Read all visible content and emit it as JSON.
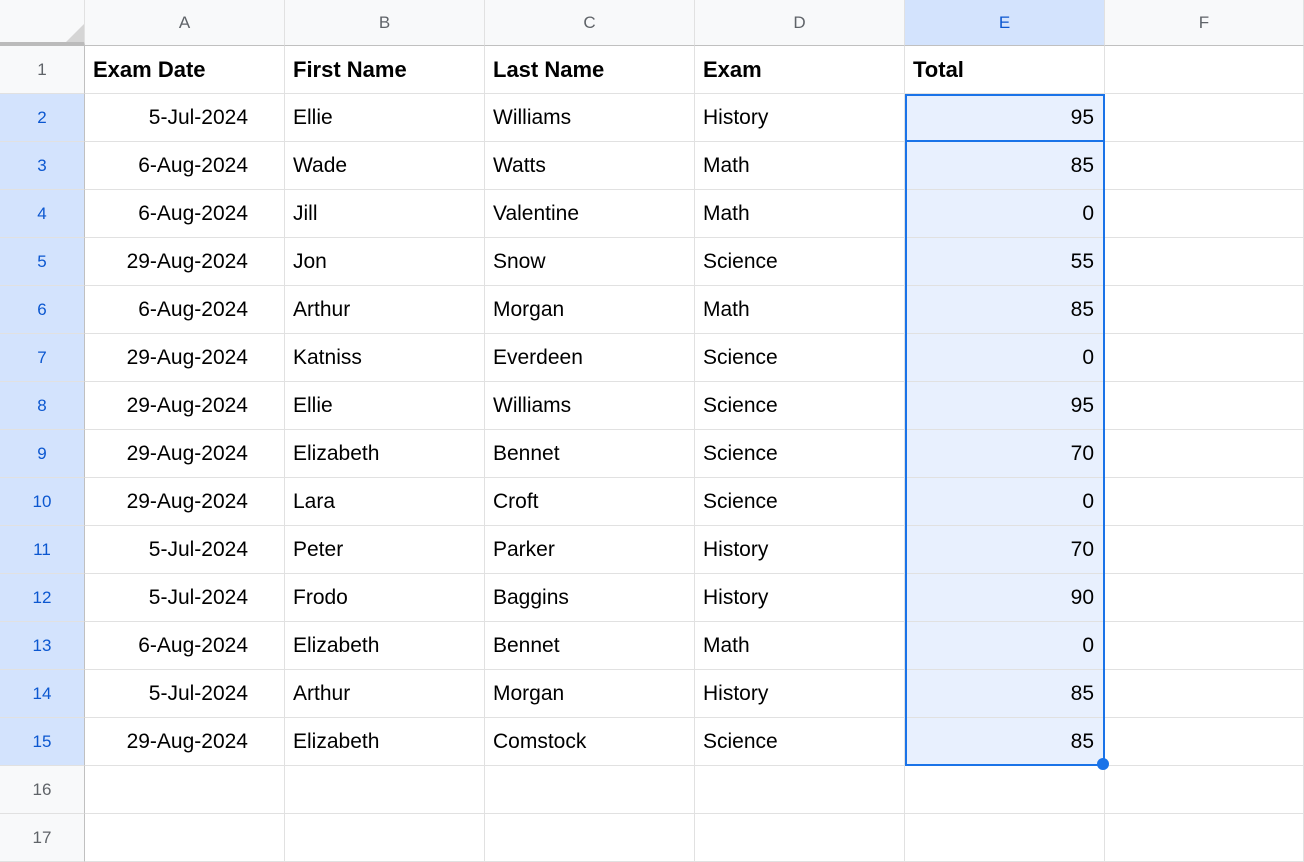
{
  "columns": [
    "A",
    "B",
    "C",
    "D",
    "E",
    "F"
  ],
  "rowNumbers": [
    "1",
    "2",
    "3",
    "4",
    "5",
    "6",
    "7",
    "8",
    "9",
    "10",
    "11",
    "12",
    "13",
    "14",
    "15",
    "16",
    "17"
  ],
  "headers": {
    "A": "Exam Date",
    "B": "First Name",
    "C": "Last Name",
    "D": "Exam",
    "E": "Total",
    "F": ""
  },
  "rows": [
    {
      "A": "5-Jul-2024",
      "B": "Ellie",
      "C": "Williams",
      "D": "History",
      "E": "95",
      "F": ""
    },
    {
      "A": "6-Aug-2024",
      "B": "Wade",
      "C": "Watts",
      "D": "Math",
      "E": "85",
      "F": ""
    },
    {
      "A": "6-Aug-2024",
      "B": "Jill",
      "C": "Valentine",
      "D": "Math",
      "E": "0",
      "F": ""
    },
    {
      "A": "29-Aug-2024",
      "B": "Jon",
      "C": "Snow",
      "D": "Science",
      "E": "55",
      "F": ""
    },
    {
      "A": "6-Aug-2024",
      "B": "Arthur",
      "C": "Morgan",
      "D": "Math",
      "E": "85",
      "F": ""
    },
    {
      "A": "29-Aug-2024",
      "B": "Katniss",
      "C": "Everdeen",
      "D": "Science",
      "E": "0",
      "F": ""
    },
    {
      "A": "29-Aug-2024",
      "B": "Ellie",
      "C": "Williams",
      "D": "Science",
      "E": "95",
      "F": ""
    },
    {
      "A": "29-Aug-2024",
      "B": "Elizabeth",
      "C": "Bennet",
      "D": "Science",
      "E": "70",
      "F": ""
    },
    {
      "A": "29-Aug-2024",
      "B": "Lara",
      "C": "Croft",
      "D": "Science",
      "E": "0",
      "F": ""
    },
    {
      "A": "5-Jul-2024",
      "B": "Peter",
      "C": "Parker",
      "D": "History",
      "E": "70",
      "F": ""
    },
    {
      "A": "5-Jul-2024",
      "B": "Frodo",
      "C": "Baggins",
      "D": "History",
      "E": "90",
      "F": ""
    },
    {
      "A": "6-Aug-2024",
      "B": "Elizabeth",
      "C": "Bennet",
      "D": "Math",
      "E": "0",
      "F": ""
    },
    {
      "A": "5-Jul-2024",
      "B": "Arthur",
      "C": "Morgan",
      "D": "History",
      "E": "85",
      "F": ""
    },
    {
      "A": "29-Aug-2024",
      "B": "Elizabeth",
      "C": "Comstock",
      "D": "Science",
      "E": "85",
      "F": ""
    }
  ],
  "selection": {
    "column": "E",
    "startRow": 2,
    "endRow": 15,
    "activeCell": "E2",
    "selectedRowHeaders": [
      2,
      3,
      4,
      5,
      6,
      7,
      8,
      9,
      10,
      11,
      12,
      13,
      14,
      15
    ]
  }
}
